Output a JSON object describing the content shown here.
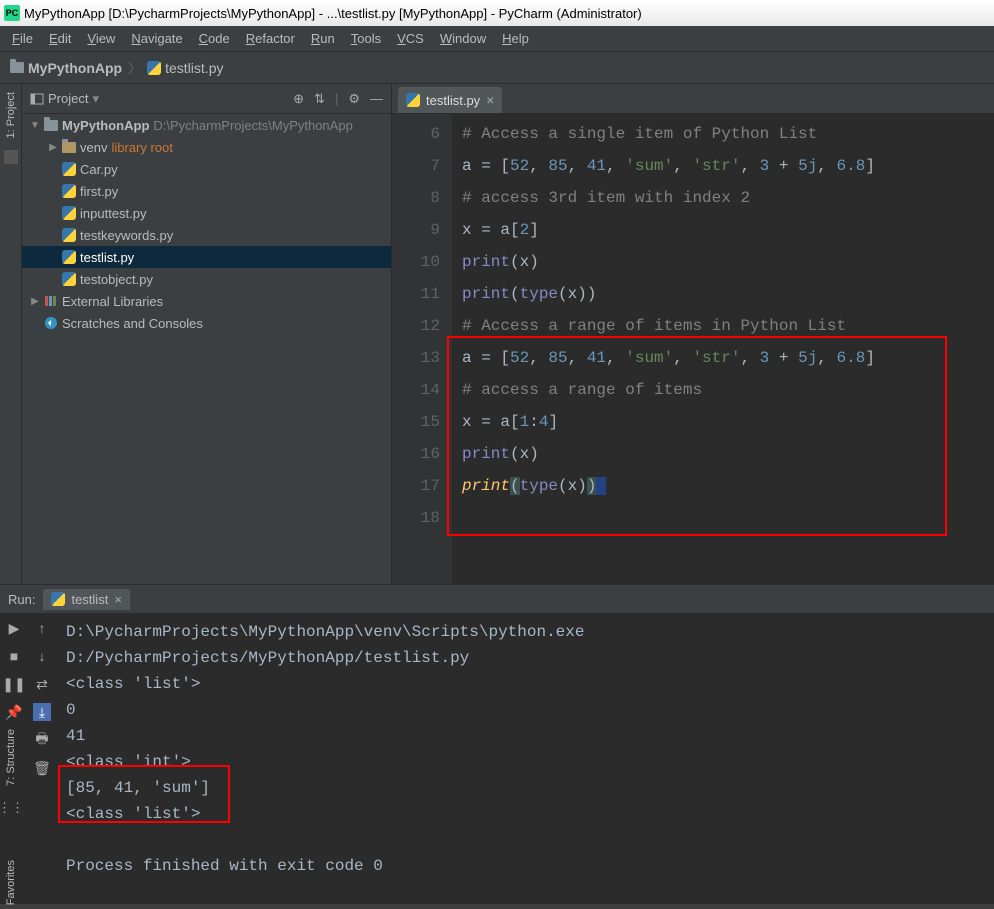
{
  "window": {
    "title": "MyPythonApp [D:\\PycharmProjects\\MyPythonApp] - ...\\testlist.py [MyPythonApp] - PyCharm (Administrator)",
    "icon_label": "PC"
  },
  "menu": [
    "File",
    "Edit",
    "View",
    "Navigate",
    "Code",
    "Refactor",
    "Run",
    "Tools",
    "VCS",
    "Window",
    "Help"
  ],
  "breadcrumb": {
    "project": "MyPythonApp",
    "file": "testlist.py"
  },
  "project_panel": {
    "title": "Project",
    "root": {
      "name": "MyPythonApp",
      "path": "D:\\PycharmProjects\\MyPythonApp"
    },
    "venv": {
      "name": "venv",
      "tag": "library root"
    },
    "files": [
      "Car.py",
      "first.py",
      "inputtest.py",
      "testkeywords.py",
      "testlist.py",
      "testobject.py"
    ],
    "selected": "testlist.py",
    "external": "External Libraries",
    "scratches": "Scratches and Consoles"
  },
  "tool_buttons": {
    "target": "⊕",
    "collapse": "⇅",
    "gear": "⚙",
    "hide": "—"
  },
  "editor_tab": "testlist.py",
  "code_lines": [
    {
      "n": 6,
      "tokens": [
        [
          "# Access a single item of Python List",
          "c-comment"
        ]
      ]
    },
    {
      "n": 7,
      "tokens": [
        [
          "a = ",
          ""
        ],
        [
          "[",
          ""
        ],
        [
          "52",
          "c-num"
        ],
        [
          ", ",
          ""
        ],
        [
          "85",
          "c-num"
        ],
        [
          ", ",
          ""
        ],
        [
          "41",
          "c-num"
        ],
        [
          ", ",
          ""
        ],
        [
          "'sum'",
          "c-str"
        ],
        [
          ", ",
          ""
        ],
        [
          "'str'",
          "c-str"
        ],
        [
          ", ",
          ""
        ],
        [
          "3",
          "c-num"
        ],
        [
          " + ",
          ""
        ],
        [
          "5j",
          "c-num"
        ],
        [
          ", ",
          ""
        ],
        [
          "6.8",
          "c-num"
        ],
        [
          "]",
          ""
        ]
      ]
    },
    {
      "n": 8,
      "tokens": [
        [
          "# access 3rd item with index 2",
          "c-comment"
        ]
      ]
    },
    {
      "n": 9,
      "tokens": [
        [
          "x = a[",
          ""
        ],
        [
          "2",
          "c-num"
        ],
        [
          "]",
          ""
        ]
      ]
    },
    {
      "n": 10,
      "tokens": [
        [
          "print",
          "c-builtin"
        ],
        [
          "(x)",
          ""
        ]
      ]
    },
    {
      "n": 11,
      "tokens": [
        [
          "print",
          "c-builtin"
        ],
        [
          "(",
          ""
        ],
        [
          "type",
          "c-builtin"
        ],
        [
          "(x))",
          ""
        ]
      ]
    },
    {
      "n": 12,
      "tokens": [
        [
          "",
          ""
        ]
      ]
    },
    {
      "n": 13,
      "tokens": [
        [
          "# Access a range of items in Python List",
          "c-comment"
        ]
      ]
    },
    {
      "n": 14,
      "tokens": [
        [
          "a = ",
          ""
        ],
        [
          "[",
          ""
        ],
        [
          "52",
          "c-num"
        ],
        [
          ", ",
          ""
        ],
        [
          "85",
          "c-num"
        ],
        [
          ", ",
          ""
        ],
        [
          "41",
          "c-num"
        ],
        [
          ", ",
          ""
        ],
        [
          "'sum'",
          "c-str"
        ],
        [
          ", ",
          ""
        ],
        [
          "'str'",
          "c-str"
        ],
        [
          ", ",
          ""
        ],
        [
          "3",
          "c-num"
        ],
        [
          " + ",
          ""
        ],
        [
          "5j",
          "c-num"
        ],
        [
          ", ",
          ""
        ],
        [
          "6.8",
          "c-num"
        ],
        [
          "]",
          ""
        ]
      ]
    },
    {
      "n": 15,
      "tokens": [
        [
          "# access a range of items",
          "c-comment"
        ]
      ]
    },
    {
      "n": 16,
      "tokens": [
        [
          "x = a[",
          ""
        ],
        [
          "1",
          "c-num"
        ],
        [
          ":",
          ""
        ],
        [
          "4",
          "c-num"
        ],
        [
          "]",
          ""
        ]
      ]
    },
    {
      "n": 17,
      "tokens": [
        [
          "print",
          "c-builtin"
        ],
        [
          "(x)",
          ""
        ]
      ]
    },
    {
      "n": 18,
      "tokens": [
        [
          "print",
          "c-fn"
        ],
        [
          "(",
          "paren-hi"
        ],
        [
          "type",
          "c-builtin"
        ],
        [
          "(x)",
          ""
        ],
        [
          ")",
          "paren-hi"
        ]
      ],
      "caret": true
    }
  ],
  "run": {
    "label": "Run:",
    "tab": "testlist",
    "output": [
      "D:\\PycharmProjects\\MyPythonApp\\venv\\Scripts\\python.exe D:/PycharmProjects/MyPythonApp/testlist.py",
      "<class 'list'>",
      "0",
      "41",
      "<class 'int'>",
      "[85, 41, 'sum']",
      "<class 'list'>",
      "",
      "Process finished with exit code 0"
    ]
  },
  "side_tools": {
    "project": "1: Project",
    "structure": "7: Structure",
    "favorites": "Favorites"
  }
}
